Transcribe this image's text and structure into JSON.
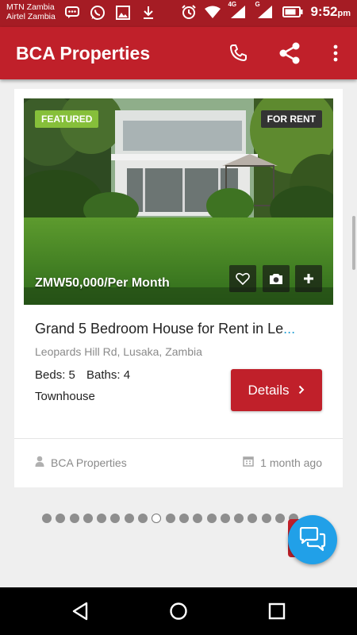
{
  "status_bar": {
    "carrier_1": "MTN Zambia",
    "carrier_2": "Airtel Zambia",
    "net_1": "4G",
    "net_2": "G",
    "time": "9:52",
    "ampm": "pm"
  },
  "app_bar": {
    "title": "BCA Properties",
    "icons": [
      "phone-icon",
      "share-icon",
      "more-vert-icon"
    ]
  },
  "listing": {
    "badge_featured": "FEATURED",
    "badge_status": "FOR RENT",
    "price": "ZMW50,000/Per Month",
    "title": "Grand 5 Bedroom House for Rent in Le",
    "title_ellipsis": "...",
    "address": "Leopards Hill Rd, Lusaka, Zambia",
    "beds": "Beds: 5",
    "baths": "Baths: 4",
    "property_type": "Townhouse",
    "details_label": "Details",
    "agent": "BCA Properties",
    "posted": "1 month ago",
    "image_actions": [
      "heart-icon",
      "camera-icon",
      "plus-icon"
    ]
  },
  "pager": {
    "total": 19,
    "active_index": 8
  },
  "colors": {
    "status_bar": "#a51c24",
    "app_bar": "#c0202a",
    "featured": "#86bf3a",
    "fab": "#21a0e8"
  }
}
